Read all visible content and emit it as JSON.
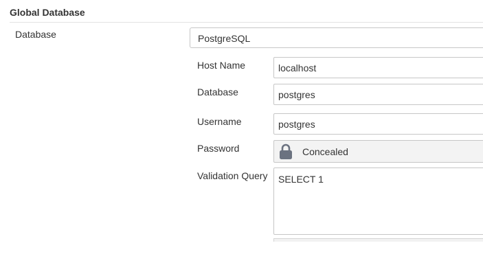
{
  "section": {
    "title": "Global Database"
  },
  "database": {
    "label": "Database",
    "selected": "PostgreSQL"
  },
  "fields": {
    "host_name": {
      "label": "Host Name",
      "value": "localhost"
    },
    "database": {
      "label": "Database",
      "value": "postgres"
    },
    "username": {
      "label": "Username",
      "value": "postgres"
    },
    "password": {
      "label": "Password",
      "value": "Concealed",
      "icon": "lock-icon"
    },
    "validation_query": {
      "label": "Validation Query",
      "value": "SELECT 1"
    }
  },
  "colors": {
    "text": "#333333",
    "border": "#c6c6c6",
    "concealed_bg": "#f3f3f3",
    "lock_icon": "#6b7280"
  }
}
